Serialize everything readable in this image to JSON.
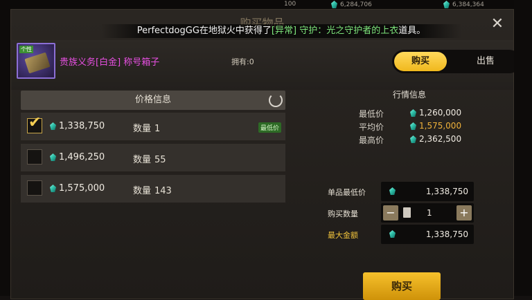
{
  "topbar": {
    "value1": "100",
    "value2": "6,284,706",
    "value3": "6,384,364"
  },
  "window": {
    "title": "购买物品",
    "close_icon": "close-icon"
  },
  "banner": {
    "prefix": "PerfectdogGG在地狱火中获得了",
    "highlight": "[异常] 守护：光之守护者的上衣",
    "suffix": "道具。"
  },
  "item": {
    "icon_tag": "个性",
    "name": "贵族义务[白金] 称号箱子",
    "owned": "拥有:0"
  },
  "tabs": {
    "buy": "购买",
    "sell": "出售"
  },
  "price_info": {
    "header": "价格信息",
    "lowest_badge": "最低价",
    "listings": [
      {
        "price": "1,338,750",
        "qty_label": "数量",
        "qty": "1",
        "checked": true,
        "lowest": true
      },
      {
        "price": "1,496,250",
        "qty_label": "数量",
        "qty": "55",
        "checked": false,
        "lowest": false
      },
      {
        "price": "1,575,000",
        "qty_label": "数量",
        "qty": "143",
        "checked": false,
        "lowest": false
      }
    ]
  },
  "market": {
    "title": "行情信息",
    "min_label": "最低价",
    "min_value": "1,260,000",
    "avg_label": "平均价",
    "avg_value": "1,575,000",
    "max_label": "最高价",
    "max_value": "2,362,500"
  },
  "purchase": {
    "unit_label": "单品最低价",
    "unit_value": "1,338,750",
    "qty_label": "购买数量",
    "qty_value": "1",
    "total_label": "最大金额",
    "total_value": "1,338,750",
    "minus": "−",
    "plus": "+",
    "buy_button": "购买"
  },
  "colors": {
    "accent_gold": "#f0b81d",
    "gem": "#2fc0a9",
    "item_name": "#e64fe0",
    "banner_highlight": "#7ee67c"
  }
}
